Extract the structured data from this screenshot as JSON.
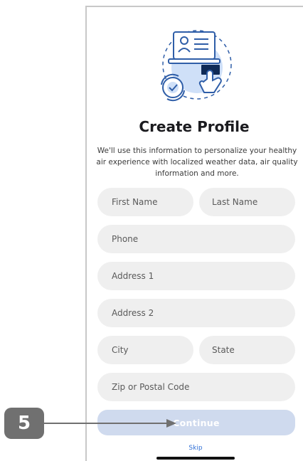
{
  "title": "Create Profile",
  "subtitle": "We'll use this information to personalize your healthy air experience with localized weather data, air quality information and more.",
  "form": {
    "first_name": {
      "placeholder": "First Name"
    },
    "last_name": {
      "placeholder": "Last Name"
    },
    "phone": {
      "placeholder": "Phone"
    },
    "address1": {
      "placeholder": "Address 1"
    },
    "address2": {
      "placeholder": "Address 2"
    },
    "city": {
      "placeholder": "City"
    },
    "state": {
      "placeholder": "State"
    },
    "zip": {
      "placeholder": "Zip or Postal Code"
    }
  },
  "continue_label": "Continue",
  "skip_label": "Skip",
  "callout": {
    "number": "5"
  },
  "colors": {
    "field_bg": "#efefef",
    "continue_disabled": "#cfdaee",
    "link": "#2f6fd6",
    "callout": "#707070",
    "illustration_blue": "#cfe0f8",
    "illustration_dark": "#0f2a56"
  },
  "icons": [
    "profile-setup-illustration"
  ]
}
